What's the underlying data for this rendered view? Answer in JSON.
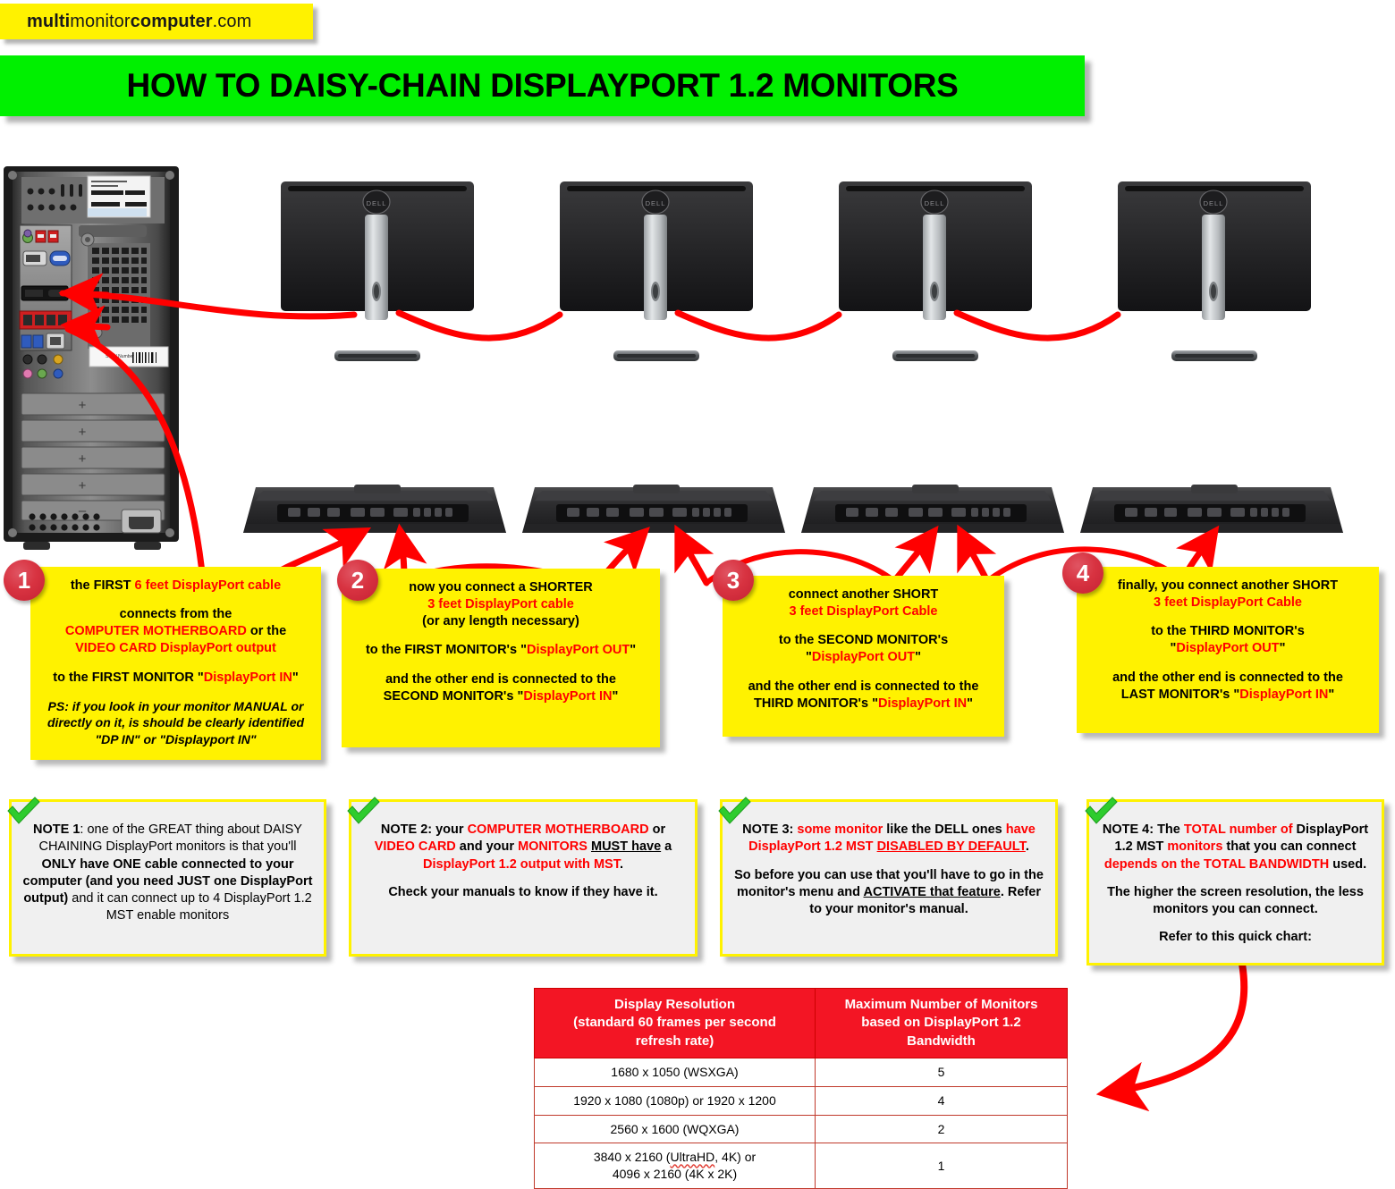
{
  "brand": {
    "prefix": "multi",
    "mid": "monitor",
    "strong": "computer",
    "suffix": ".com"
  },
  "title": "HOW TO DAISY-CHAIN DISPLAYPORT 1.2 MONITORS",
  "colors": {
    "banner_green": "#00F000",
    "callout_yellow": "#FFF200",
    "cable_red": "#FF0000",
    "table_header_red": "#F31524",
    "note_fill": "#F0F0F0"
  },
  "hardware": {
    "tower_label": "computer-tower-rear",
    "monitor_brand": "DELL",
    "monitors_top": [
      "monitor-1-rear",
      "monitor-2-rear",
      "monitor-3-rear",
      "monitor-4-rear"
    ],
    "monitors_bottom": [
      "monitor-1-ports",
      "monitor-2-ports",
      "monitor-3-ports",
      "monitor-4-ports"
    ]
  },
  "steps": [
    {
      "number": "1",
      "lines": [
        [
          {
            "t": "the FIRST ",
            "c": "black"
          },
          {
            "t": "6 feet DisplayPort cable",
            "c": "red"
          }
        ],
        [
          {
            "t": "connects from the",
            "c": "black"
          }
        ],
        [
          {
            "t": "COMPUTER MOTHERBOARD",
            "c": "red"
          },
          {
            "t": " or the",
            "c": "black"
          }
        ],
        [
          {
            "t": "VIDEO CARD DisplayPort output",
            "c": "red"
          }
        ],
        [
          {
            "t": "to the FIRST MONITOR \"",
            "c": "black"
          },
          {
            "t": "DisplayPort IN",
            "c": "red"
          },
          {
            "t": "\"",
            "c": "black"
          }
        ]
      ],
      "ps": [
        "PS: if you look in your monitor MANUAL or",
        "directly on it, is should be clearly identified",
        "\"DP IN\" or \"Displayport IN\""
      ]
    },
    {
      "number": "2",
      "lines": [
        [
          {
            "t": "now you connect a SHORTER",
            "c": "black"
          }
        ],
        [
          {
            "t": "3 feet DisplayPort cable",
            "c": "red"
          }
        ],
        [
          {
            "t": "(or any length necessary)",
            "c": "black"
          }
        ],
        [
          {
            "t": "to the FIRST MONITOR's \"",
            "c": "black"
          },
          {
            "t": "DisplayPort OUT",
            "c": "red"
          },
          {
            "t": "\"",
            "c": "black"
          }
        ],
        [
          {
            "t": "and the other end is connected to the",
            "c": "black"
          }
        ],
        [
          {
            "t": "SECOND MONITOR's \"",
            "c": "black"
          },
          {
            "t": "DisplayPort IN",
            "c": "red"
          },
          {
            "t": "\"",
            "c": "black"
          }
        ]
      ],
      "ps": []
    },
    {
      "number": "3",
      "lines": [
        [
          {
            "t": "connect another SHORT",
            "c": "black"
          }
        ],
        [
          {
            "t": "3 feet DisplayPort Cable",
            "c": "red"
          }
        ],
        [
          {
            "t": "to the SECOND MONITOR's",
            "c": "black"
          }
        ],
        [
          {
            "t": "\"",
            "c": "black"
          },
          {
            "t": "DisplayPort OUT",
            "c": "red"
          },
          {
            "t": "\"",
            "c": "black"
          }
        ],
        [
          {
            "t": "and the other end is connected to the",
            "c": "black"
          }
        ],
        [
          {
            "t": "THIRD MONITOR's \"",
            "c": "black"
          },
          {
            "t": "DisplayPort IN",
            "c": "red"
          },
          {
            "t": "\"",
            "c": "black"
          }
        ]
      ],
      "ps": []
    },
    {
      "number": "4",
      "lines": [
        [
          {
            "t": "finally, you connect another SHORT",
            "c": "black"
          }
        ],
        [
          {
            "t": "3 feet DisplayPort Cable",
            "c": "red"
          }
        ],
        [
          {
            "t": "to the THIRD MONITOR's",
            "c": "black"
          }
        ],
        [
          {
            "t": "\"",
            "c": "black"
          },
          {
            "t": "DisplayPort OUT",
            "c": "red"
          },
          {
            "t": "\"",
            "c": "black"
          }
        ],
        [
          {
            "t": "and the other end is connected to the",
            "c": "black"
          }
        ],
        [
          {
            "t": "LAST MONITOR's \"",
            "c": "black"
          },
          {
            "t": "DisplayPort IN",
            "c": "red"
          },
          {
            "t": "\"",
            "c": "black"
          }
        ]
      ],
      "ps": []
    }
  ],
  "notes": [
    {
      "id": "note-1",
      "paragraphs": [
        [
          {
            "t": "NOTE 1",
            "s": "b"
          },
          {
            "t": ": one of the GREAT thing about DAISY CHAINING DisplayPort monitors is that you'll "
          },
          {
            "t": "ONLY have ONE cable connected to your computer (and you need JUST one DisplayPort output)",
            "s": "b"
          },
          {
            "t": " and it can connect up to 4 DisplayPort 1.2 MST enable monitors"
          }
        ]
      ]
    },
    {
      "id": "note-2",
      "paragraphs": [
        [
          {
            "t": "NOTE 2: your ",
            "s": "b"
          },
          {
            "t": "COMPUTER MOTHERBOARD",
            "s": "b",
            "c": "red"
          },
          {
            "t": " or ",
            "s": "b"
          },
          {
            "t": "VIDEO CARD",
            "s": "b",
            "c": "red"
          },
          {
            "t": " and your ",
            "s": "b"
          },
          {
            "t": "MONITORS",
            "s": "b",
            "c": "red"
          },
          {
            "t": " ",
            "s": "b"
          },
          {
            "t": "MUST have",
            "s": "bu"
          },
          {
            "t": " a ",
            "s": "b"
          },
          {
            "t": "DisplayPort 1.2 output with MST",
            "s": "b",
            "c": "red"
          },
          {
            "t": ".",
            "s": "b"
          }
        ],
        [
          {
            "t": "Check your manuals to know if they have it.",
            "s": "b"
          }
        ]
      ]
    },
    {
      "id": "note-3",
      "paragraphs": [
        [
          {
            "t": "NOTE 3: ",
            "s": "b"
          },
          {
            "t": "some monitor",
            "s": "b",
            "c": "red"
          },
          {
            "t": " like the DELL ones ",
            "s": "b"
          },
          {
            "t": "have DisplayPort 1.2 MST ",
            "s": "b",
            "c": "red"
          },
          {
            "t": "DISABLED BY DEFAULT",
            "s": "bu",
            "c": "red"
          },
          {
            "t": ".",
            "s": "b"
          }
        ],
        [
          {
            "t": "So before you can use that you'll have to go in the monitor's menu and ",
            "s": "b"
          },
          {
            "t": "ACTIVATE that feature",
            "s": "bu"
          },
          {
            "t": ". Refer to your monitor's manual.",
            "s": "b"
          }
        ]
      ]
    },
    {
      "id": "note-4",
      "paragraphs": [
        [
          {
            "t": "NOTE 4:  The ",
            "s": "b"
          },
          {
            "t": "TOTAL number of",
            "s": "b",
            "c": "red"
          },
          {
            "t": " DisplayPort 1.2 MST ",
            "s": "b"
          },
          {
            "t": "monitors",
            "s": "b",
            "c": "red"
          },
          {
            "t": " that you can connect ",
            "s": "b"
          },
          {
            "t": "depends on the TOTAL BANDWIDTH",
            "s": "b",
            "c": "red"
          },
          {
            "t": " used.",
            "s": "b"
          }
        ],
        [
          {
            "t": "The higher the screen resolution, the less monitors you can connect.",
            "s": "b"
          }
        ],
        [
          {
            "t": "Refer to this quick chart:",
            "s": "b"
          }
        ]
      ]
    }
  ],
  "chart_data": {
    "type": "table",
    "title": "",
    "headers": [
      "Display Resolution (standard 60 frames per second refresh rate)",
      "Maximum Number of Monitors based on DisplayPort 1.2 Bandwidth"
    ],
    "header_lines": [
      [
        "Display Resolution",
        "(standard 60 frames per second",
        "refresh rate)"
      ],
      [
        "Maximum Number of Monitors",
        "based on DisplayPort 1.2",
        "Bandwidth"
      ]
    ],
    "rows": [
      {
        "resolution": "1680 x 1050 (WSXGA)",
        "resolution_lines": [
          "1680 x 1050 (WSXGA)"
        ],
        "max_monitors": "5"
      },
      {
        "resolution": "1920 x 1080 (1080p) or 1920 x 1200",
        "resolution_lines": [
          "1920 x 1080 (1080p) or 1920 x 1200"
        ],
        "max_monitors": "4"
      },
      {
        "resolution": "2560 x 1600 (WQXGA)",
        "resolution_lines": [
          "2560 x 1600 (WQXGA)"
        ],
        "max_monitors": "2"
      },
      {
        "resolution": "3840 x 2160 (UltraHD, 4K) or 4096 x 2160 (4K x 2K)",
        "resolution_lines": [
          "3840 x 2160 (UltraHD, 4K) or",
          "4096 x 2160 (4K x 2K)"
        ],
        "max_monitors": "1",
        "spellcheck_word": "UltraHD"
      }
    ]
  }
}
